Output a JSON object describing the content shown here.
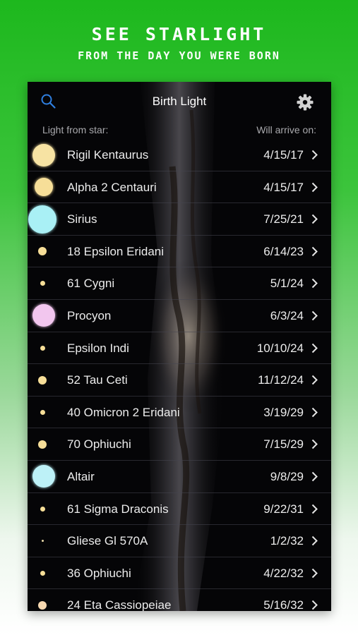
{
  "promo": {
    "title": "SEE STARLIGHT",
    "subtitle": "FROM THE DAY YOU WERE BORN"
  },
  "nav": {
    "title": "Birth Light",
    "search_icon": "search-icon",
    "settings_icon": "gear-icon"
  },
  "columns": {
    "left": "Light from star:",
    "right": "Will arrive on:"
  },
  "colors": {
    "promo_green": "#1db81d",
    "screen_bg": "#050507",
    "accent_blue": "#2f7fe0"
  },
  "stars": [
    {
      "name": "Rigil Kentaurus",
      "date": "4/15/17",
      "color": "#f7e3a3",
      "size": "large"
    },
    {
      "name": "Alpha 2 Centauri",
      "date": "4/15/17",
      "color": "#f6de98",
      "size": "medium"
    },
    {
      "name": "Sirius",
      "date": "7/25/21",
      "color": "#a9f0f5",
      "size": "xlarge"
    },
    {
      "name": "18 Epsilon Eridani",
      "date": "6/14/23",
      "color": "#f6de98",
      "size": "small"
    },
    {
      "name": "61 Cygni",
      "date": "5/1/24",
      "color": "#f6de98",
      "size": "tiny"
    },
    {
      "name": "Procyon",
      "date": "6/3/24",
      "color": "#f2c6ee",
      "size": "large"
    },
    {
      "name": "Epsilon Indi",
      "date": "10/10/24",
      "color": "#f6de98",
      "size": "tiny"
    },
    {
      "name": "52 Tau Ceti",
      "date": "11/12/24",
      "color": "#f6de98",
      "size": "small"
    },
    {
      "name": "40 Omicron 2 Eridani",
      "date": "3/19/29",
      "color": "#f6de98",
      "size": "tiny"
    },
    {
      "name": "70 Ophiuchi",
      "date": "7/15/29",
      "color": "#f6de98",
      "size": "small"
    },
    {
      "name": "Altair",
      "date": "9/8/29",
      "color": "#bdf1f7",
      "size": "large"
    },
    {
      "name": "61 Sigma Draconis",
      "date": "9/22/31",
      "color": "#f6de98",
      "size": "tiny"
    },
    {
      "name": "Gliese Gl 570A",
      "date": "1/2/32",
      "color": "#e8d9a8",
      "size": "dot"
    },
    {
      "name": "36 Ophiuchi",
      "date": "4/22/32",
      "color": "#f6de98",
      "size": "tiny"
    },
    {
      "name": "24 Eta Cassiopeiae",
      "date": "5/16/32",
      "color": "#f6d8b0",
      "size": "small"
    }
  ]
}
